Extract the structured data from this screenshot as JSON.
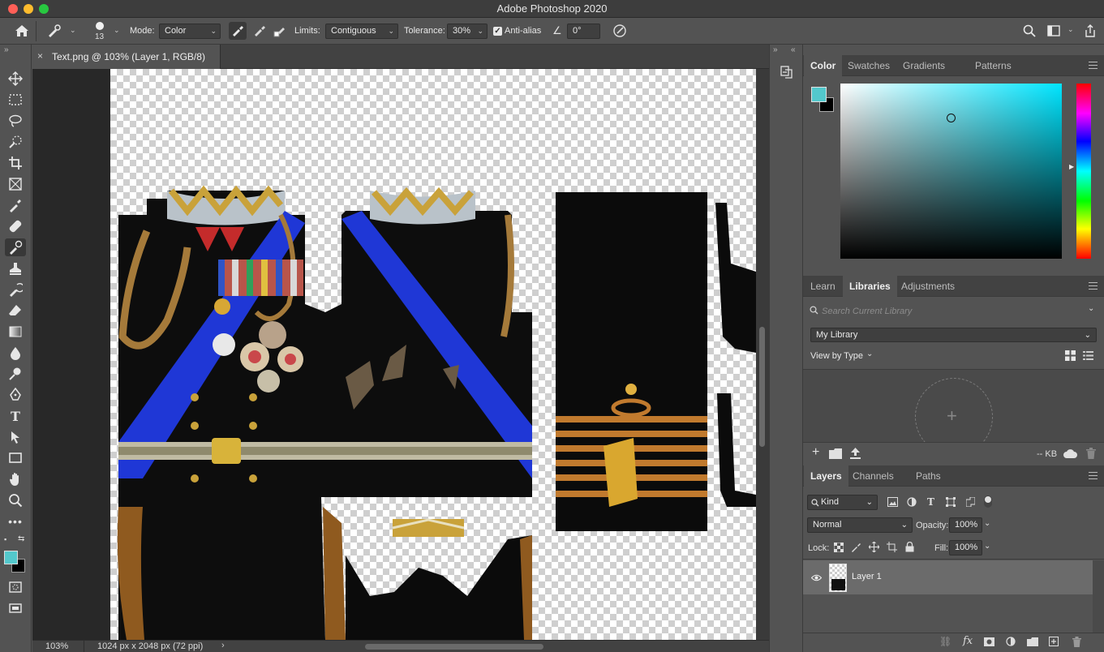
{
  "app": {
    "title": "Adobe Photoshop 2020"
  },
  "options_bar": {
    "brush_size": "13",
    "mode_label": "Mode:",
    "mode_value": "Color",
    "limits_label": "Limits:",
    "limits_value": "Contiguous",
    "tolerance_label": "Tolerance:",
    "tolerance_value": "30%",
    "anti_alias_label": "Anti-alias",
    "anti_alias_checked": true,
    "angle_value": "0°"
  },
  "document": {
    "tab_title": "Text.png @ 103% (Layer 1, RGB/8)",
    "close_glyph": "×"
  },
  "status": {
    "zoom": "103%",
    "doc_info": "1024 px x 2048 px (72 ppi)"
  },
  "colors": {
    "foreground": "#53c8cc",
    "background": "#000000",
    "accent": "#2f6bd6"
  },
  "color_panel": {
    "tabs": [
      "Color",
      "Swatches",
      "Gradients",
      "Patterns"
    ],
    "active_tab": "Color"
  },
  "libraries_panel": {
    "tabs": [
      "Learn",
      "Libraries",
      "Adjustments"
    ],
    "active_tab": "Libraries",
    "search_placeholder": "Search Current Library",
    "library_name": "My Library",
    "view_by": "View by Type",
    "storage": "-- KB"
  },
  "layers_panel": {
    "tabs": [
      "Layers",
      "Channels",
      "Paths"
    ],
    "active_tab": "Layers",
    "kind_filter": "Kind",
    "blend_mode": "Normal",
    "opacity_label": "Opacity:",
    "opacity_value": "100%",
    "lock_label": "Lock:",
    "fill_label": "Fill:",
    "fill_value": "100%",
    "layers": [
      {
        "name": "Layer 1",
        "visible": true,
        "selected": true
      }
    ]
  }
}
